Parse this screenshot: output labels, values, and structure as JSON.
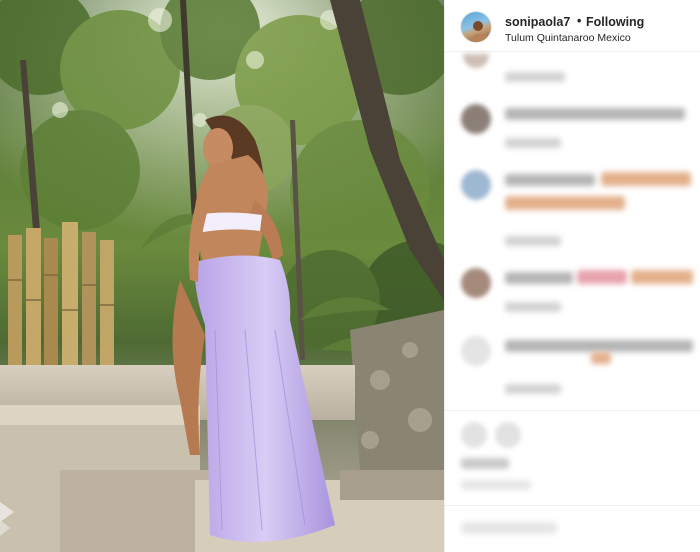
{
  "post": {
    "username": "sonipaola7",
    "separator": "•",
    "follow_status": "Following",
    "location": "Tulum Quintanaroo Mexico"
  },
  "icons": {
    "avatar": "profile-avatar",
    "watermark": "site-watermark-logo"
  },
  "colors": {
    "text": "#262626",
    "border": "#efefef",
    "skirt": "#c9b6ee",
    "foliage": "#5f7e3a"
  }
}
